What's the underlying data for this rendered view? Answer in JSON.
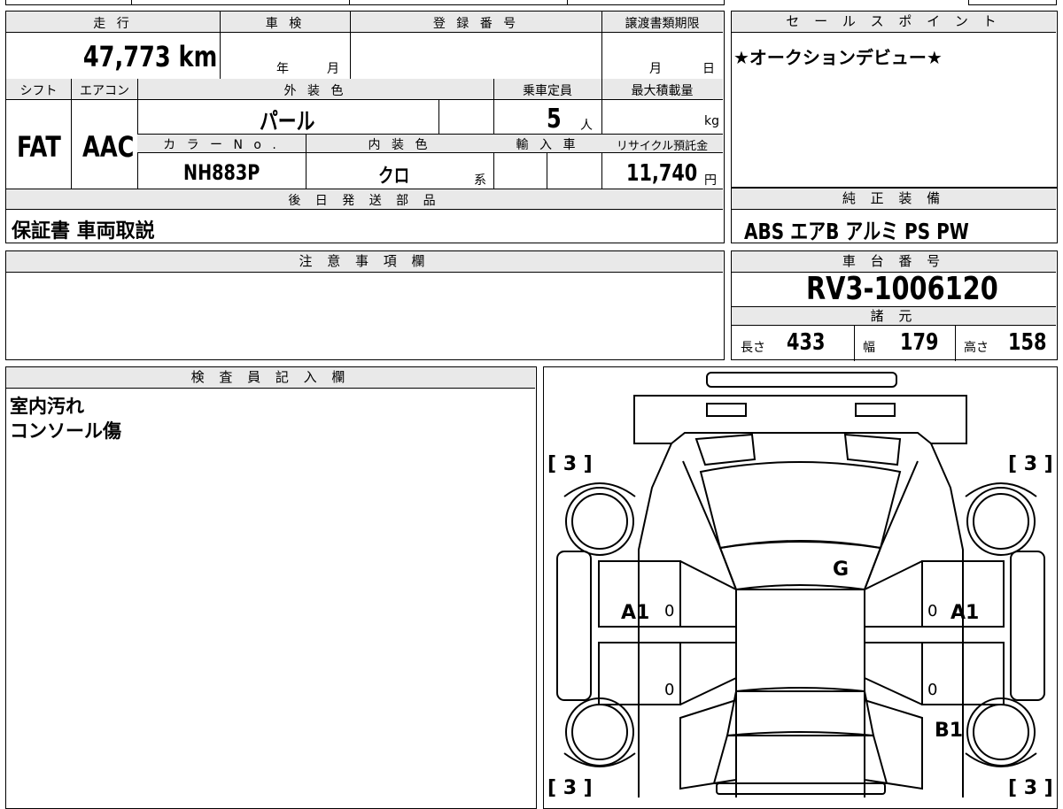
{
  "top_table": {
    "mileage_label": "走 行",
    "mileage_value": "47,773 km",
    "inspection_label": "車 検",
    "inspection_year_unit": "年",
    "inspection_month_unit": "月",
    "registration_label": "登 録 番 号",
    "transfer_deadline_label": "譲渡書類期限",
    "transfer_month_unit": "月",
    "transfer_day_unit": "日",
    "shift_label": "シフト",
    "shift_value": "FAT",
    "aircon_label": "エアコン",
    "aircon_value": "AAC",
    "exterior_color_label": "外 装 色",
    "exterior_color_value": "パール",
    "capacity_label": "乗車定員",
    "capacity_value": "5",
    "capacity_unit": "人",
    "max_load_label": "最大積載量",
    "max_load_unit": "kg",
    "color_no_label": "カ ラ ー N o .",
    "color_no_value": "NH883P",
    "interior_color_label": "内 装 色",
    "interior_color_value": "クロ",
    "interior_color_suffix": "系",
    "import_label": "輸 入 車",
    "recycle_label": "リサイクル預託金",
    "recycle_value": "11,740",
    "recycle_unit": "円",
    "later_parts_label": "後 日 発 送 部 品",
    "later_parts_value": "保証書 車両取説"
  },
  "sales_point": {
    "label": "セ ー ル ス ポ イ ン ト",
    "value": "★オークションデビュー★"
  },
  "genuine_equipment": {
    "label": "純 正 装 備",
    "value": "ABS エアB アルミ PS PW"
  },
  "notes": {
    "label": "注 意 事 項 欄"
  },
  "chassis": {
    "label": "車 台 番 号",
    "value": "RV3-1006120",
    "specs_label": "諸 元",
    "length_label": "長さ",
    "length_value": "433",
    "width_label": "幅",
    "width_value": "179",
    "height_label": "高さ",
    "height_value": "158"
  },
  "inspector": {
    "label": "検 査 員 記 入 欄",
    "line1": "室内汚れ",
    "line2": "コンソール傷"
  },
  "diagram": {
    "tire_tl": "[ 3 ]",
    "tire_tr": "[ 3 ]",
    "tire_bl": "[ 3 ]",
    "tire_br": "[ 3 ]",
    "mark_g": "G",
    "mark_a1_left": "A1",
    "mark_a1_right": "A1",
    "mark_b1": "B1",
    "zero": "0"
  }
}
